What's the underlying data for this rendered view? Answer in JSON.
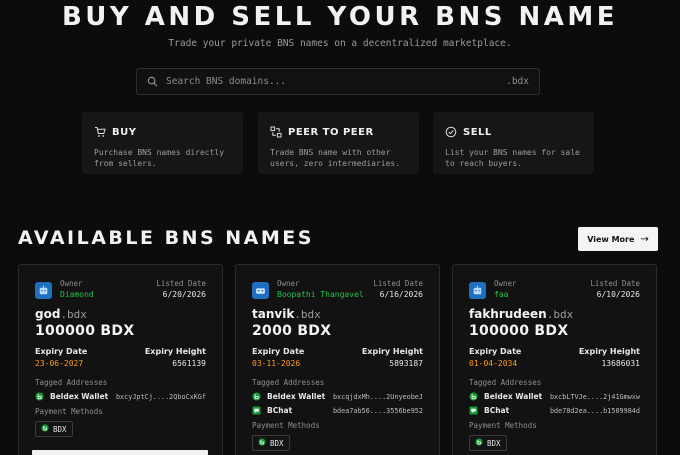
{
  "hero": {
    "title": "BUY AND SELL YOUR BNS NAME",
    "subtitle": "Trade your private BNS names on a decentralized marketplace."
  },
  "search": {
    "placeholder": "Search BNS domains...",
    "suffix": ".bdx",
    "icon": "search-icon"
  },
  "features": [
    {
      "title": "BUY",
      "icon": "cart-icon",
      "desc_line1": "Purchase BNS names directly",
      "desc_line2": "from sellers."
    },
    {
      "title": "PEER TO PEER",
      "icon": "peer-to-peer-icon",
      "desc_line1": "Trade BNS name with other",
      "desc_line2": "users, zero intermediaries."
    },
    {
      "title": "SELL",
      "icon": "check-circle-icon",
      "desc_line1": "List your BNS names for sale",
      "desc_line2": "to reach buyers."
    }
  ],
  "section": {
    "title": "AVAILABLE BNS NAMES",
    "view_more": "View More",
    "view_more_arrow": "→"
  },
  "card_labels": {
    "owner": "Owner",
    "listed_date": "Listed Date",
    "expiry_date": "Expiry Date",
    "expiry_height": "Expiry Height",
    "tagged_addresses": "Tagged Addresses",
    "payment_methods": "Payment Methods",
    "payment_chip": "BDX"
  },
  "cards": [
    {
      "owner": "Diamond",
      "listed_date": "6/20/2026",
      "name": "god",
      "tld": ".bdx",
      "price": "100000 BDX",
      "expiry_date": "23-06-2027",
      "expiry_height": "6561139",
      "addresses": [
        {
          "name": "Beldex Wallet",
          "value": "bxcyJptCj....2QboCxKGf",
          "icon": "beldex-icon"
        }
      ]
    },
    {
      "owner": "Boopathi Thangavel",
      "listed_date": "6/16/2026",
      "name": "tanvik",
      "tld": ".bdx",
      "price": "2000 BDX",
      "expiry_date": "03-11-2026",
      "expiry_height": "5893187",
      "addresses": [
        {
          "name": "Beldex Wallet",
          "value": "bxcqjdxMh....2UnyeobeJ",
          "icon": "beldex-icon"
        },
        {
          "name": "BChat",
          "value": "bdea7ab56....3556be952",
          "icon": "bchat-icon"
        }
      ]
    },
    {
      "owner": "faa",
      "listed_date": "6/10/2026",
      "name": "fakhrudeen",
      "tld": ".bdx",
      "price": "100000 BDX",
      "expiry_date": "01-04-2034",
      "expiry_height": "13686031",
      "addresses": [
        {
          "name": "Beldex Wallet",
          "value": "bxcbLTVJe....2j41Gmwxw",
          "icon": "beldex-icon"
        },
        {
          "name": "BChat",
          "value": "bde78d2ea....b1509984d",
          "icon": "bchat-icon"
        }
      ]
    }
  ],
  "colors": {
    "background": "#0b0b0b",
    "card": "#121212",
    "owner_green": "#27c24c",
    "expiry_orange": "#ff9a1f",
    "avatar_blue": "#1f6fbf"
  }
}
